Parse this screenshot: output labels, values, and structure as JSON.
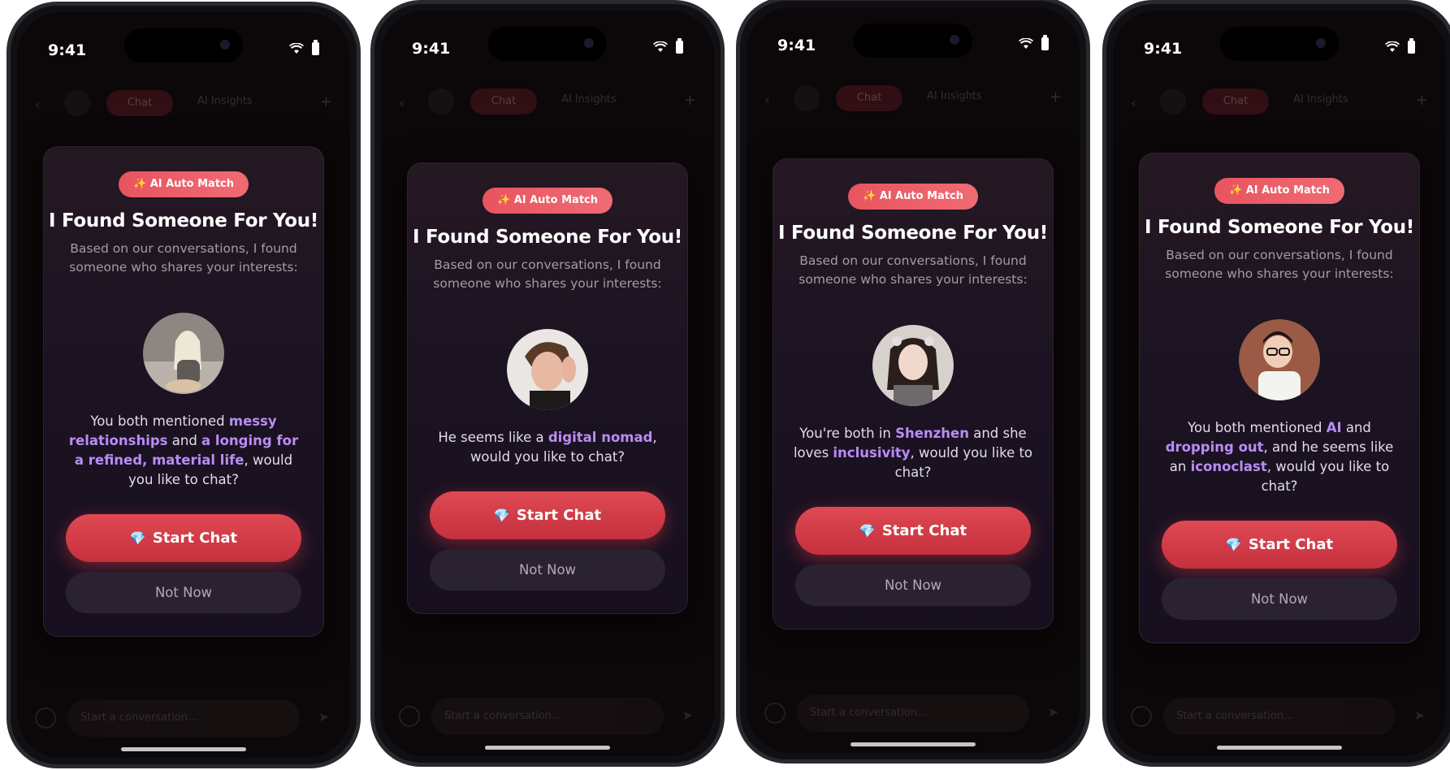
{
  "status_time": "9:41",
  "bg": {
    "tab_chat": "Chat",
    "tab_insights": "AI Insights",
    "input_placeholder": "Start a conversation..."
  },
  "modal": {
    "badge": "✨ AI Auto Match",
    "title": "I Found Someone For You!",
    "subtitle": "Based on our conversations, I found someone who shares your interests:",
    "start_label": "Start Chat",
    "not_now_label": "Not Now",
    "gem_icon": "gem-icon"
  },
  "screens": [
    {
      "message_parts": [
        {
          "t": "You both mentioned ",
          "hl": false
        },
        {
          "t": "messy relationships",
          "hl": true
        },
        {
          "t": " and ",
          "hl": false
        },
        {
          "t": "a longing for a refined, material life",
          "hl": true
        },
        {
          "t": ", would you like to chat?",
          "hl": false
        }
      ]
    },
    {
      "message_parts": [
        {
          "t": "He seems like a ",
          "hl": false
        },
        {
          "t": "digital nomad",
          "hl": true
        },
        {
          "t": ", would you like to chat?",
          "hl": false
        }
      ]
    },
    {
      "message_parts": [
        {
          "t": "You're both in ",
          "hl": false
        },
        {
          "t": "Shenzhen",
          "hl": true
        },
        {
          "t": " and she loves ",
          "hl": false
        },
        {
          "t": "inclusivity",
          "hl": true
        },
        {
          "t": ", would you like to chat?",
          "hl": false
        }
      ]
    },
    {
      "message_parts": [
        {
          "t": "You both mentioned ",
          "hl": false
        },
        {
          "t": "AI",
          "hl": true
        },
        {
          "t": " and ",
          "hl": false
        },
        {
          "t": "dropping out",
          "hl": true
        },
        {
          "t": ", and he seems like an ",
          "hl": false
        },
        {
          "t": "iconoclast",
          "hl": true
        },
        {
          "t": ", would you like to chat?",
          "hl": false
        }
      ]
    }
  ],
  "colors": {
    "accent_red": "#d93c48",
    "highlight_purple": "#b98cf5",
    "badge_red": "#ec5f69"
  }
}
